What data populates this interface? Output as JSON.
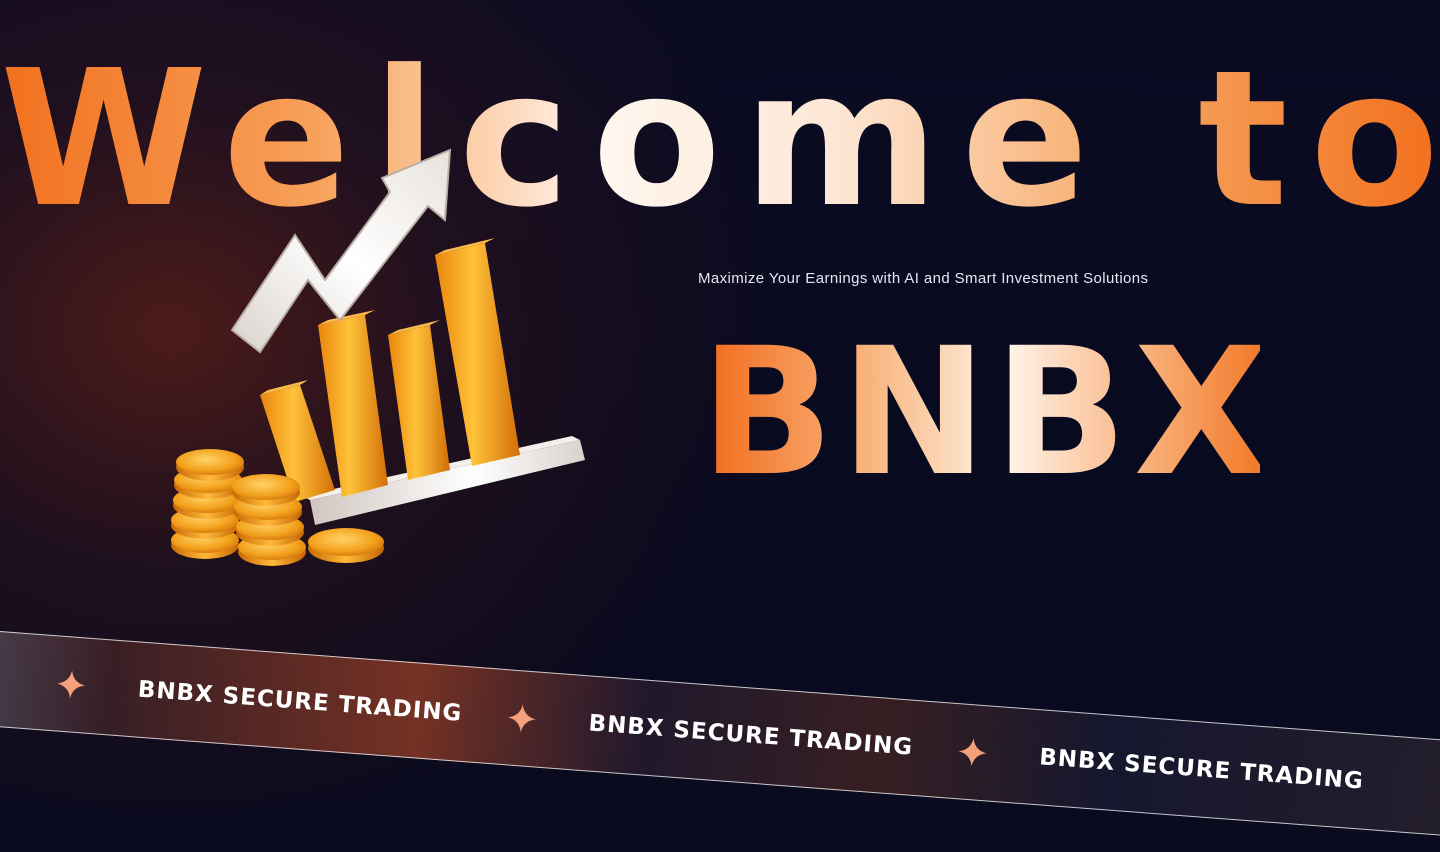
{
  "hero": {
    "headline": "Welcome to",
    "brand": "BNBX",
    "tagline": "Maximize Your Earnings with AI and Smart Investment Solutions"
  },
  "ribbon": {
    "items": [
      {
        "label": "BNBX SECURE TRADING",
        "icon": "sparkle-icon"
      },
      {
        "label": "BNBX SECURE TRADING",
        "icon": "sparkle-icon"
      },
      {
        "label": "BNBX SECURE TRADING",
        "icon": "sparkle-icon"
      }
    ]
  },
  "illustration": {
    "icon": "growth-chart-with-coins-icon"
  },
  "colors": {
    "background": "#080a1f",
    "accent_orange": "#f2701e",
    "accent_light": "#fff6ee",
    "ribbon_text": "#ffffff"
  }
}
